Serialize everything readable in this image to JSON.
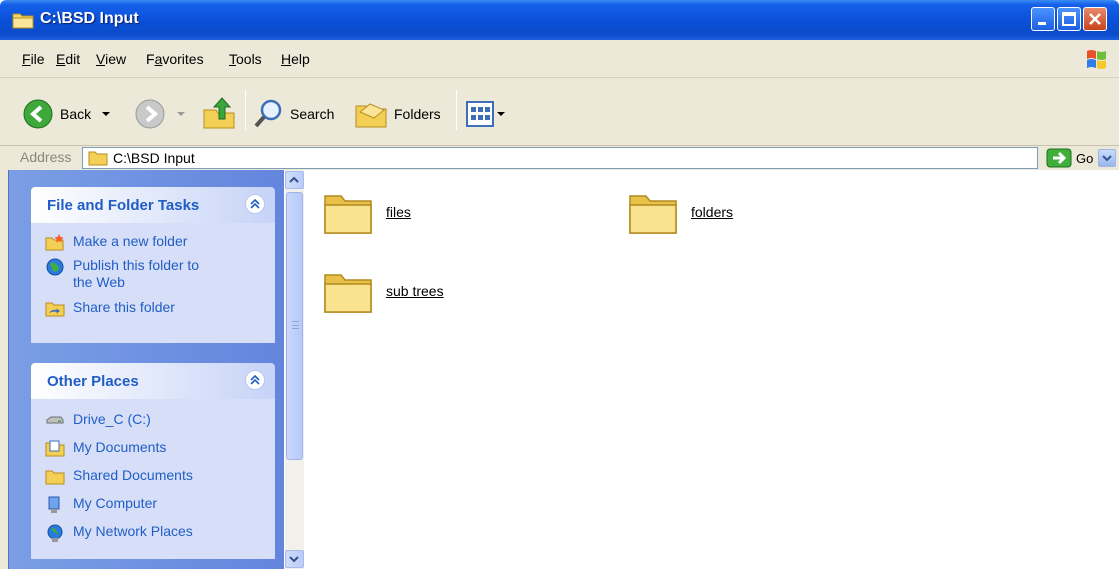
{
  "window": {
    "title": "C:\\BSD Input"
  },
  "menu": {
    "items": [
      {
        "pre": "",
        "key": "F",
        "post": "ile"
      },
      {
        "pre": "",
        "key": "E",
        "post": "dit"
      },
      {
        "pre": "",
        "key": "V",
        "post": "iew"
      },
      {
        "pre": "F",
        "key": "a",
        "post": "vorites"
      },
      {
        "pre": "",
        "key": "T",
        "post": "ools"
      },
      {
        "pre": "",
        "key": "H",
        "post": "elp"
      }
    ]
  },
  "toolbar": {
    "back_label": "Back",
    "search_label": "Search",
    "folders_label": "Folders"
  },
  "address": {
    "label": "Address",
    "value": "C:\\BSD Input",
    "go_label": "Go"
  },
  "tasks_panel": {
    "title": "File and Folder Tasks",
    "items": [
      {
        "label": "Make a new folder",
        "icon": "new-folder-icon"
      },
      {
        "label": "Publish this folder to the Web",
        "icon": "publish-web-icon"
      },
      {
        "label": "Share this folder",
        "icon": "share-folder-icon"
      }
    ]
  },
  "places_panel": {
    "title": "Other Places",
    "items": [
      {
        "label": "Drive_C (C:)",
        "icon": "drive-icon"
      },
      {
        "label": "My Documents",
        "icon": "my-documents-icon"
      },
      {
        "label": "Shared Documents",
        "icon": "shared-documents-icon"
      },
      {
        "label": "My Computer",
        "icon": "my-computer-icon"
      },
      {
        "label": "My Network Places",
        "icon": "network-places-icon"
      }
    ]
  },
  "folders": [
    {
      "name": "files"
    },
    {
      "name": "folders"
    },
    {
      "name": "sub trees"
    }
  ],
  "colors": {
    "titlebar": "#0a4fd8",
    "chrome": "#ece9d8",
    "taskpane": "#6b8de1",
    "link": "#215dc6"
  }
}
